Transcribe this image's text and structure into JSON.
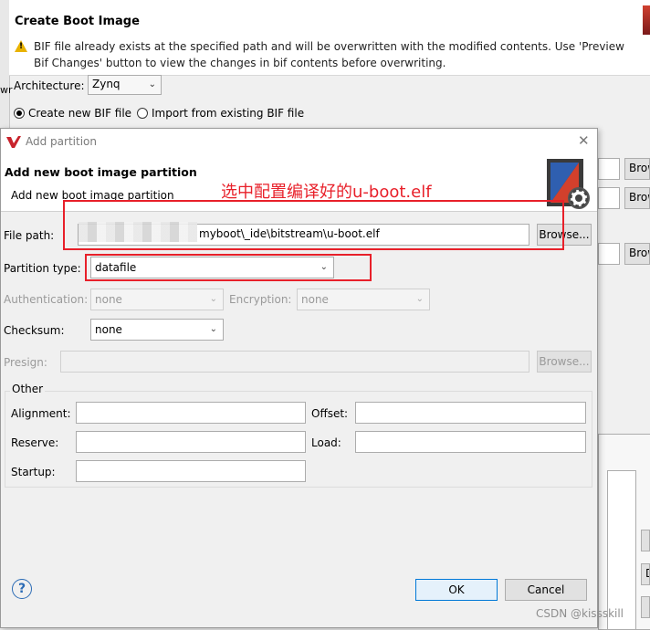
{
  "background_dialog": {
    "title": "Create Boot Image",
    "warning": "BIF file already exists at the specified path and will be overwritten with the modified contents. Use 'Preview Bif Changes' button to view the changes in bif contents before overwriting.",
    "architecture_label": "Architecture:",
    "architecture_value": "Zynq",
    "radio_create": "Create new BIF file",
    "radio_import": "Import from existing BIF file",
    "side_buttons": [
      "Brow",
      "Brow",
      "Brow"
    ],
    "side_letters": [
      "wr",
      "D"
    ]
  },
  "dialog": {
    "title": "Add partition",
    "banner_title": "Add new boot image partition",
    "banner_subtitle": "Add new boot image partition",
    "file_path_label": "File path:",
    "file_path_value": "myboot\\_ide\\bitstream\\u-boot.elf",
    "browse_label": "Browse...",
    "partition_type_label": "Partition type:",
    "partition_type_value": "datafile",
    "authentication_label": "Authentication:",
    "authentication_value": "none",
    "encryption_label": "Encryption:",
    "encryption_value": "none",
    "checksum_label": "Checksum:",
    "checksum_value": "none",
    "presign_label": "Presign:",
    "presign_browse": "Browse...",
    "other_legend": "Other",
    "alignment_label": "Alignment:",
    "offset_label": "Offset:",
    "reserve_label": "Reserve:",
    "load_label": "Load:",
    "startup_label": "Startup:",
    "ok_label": "OK",
    "cancel_label": "Cancel",
    "help_symbol": "?"
  },
  "annotation": {
    "text": "选中配置编译好的u-boot.elf",
    "color": "#e8202a"
  },
  "watermark": "CSDN @kissskill"
}
